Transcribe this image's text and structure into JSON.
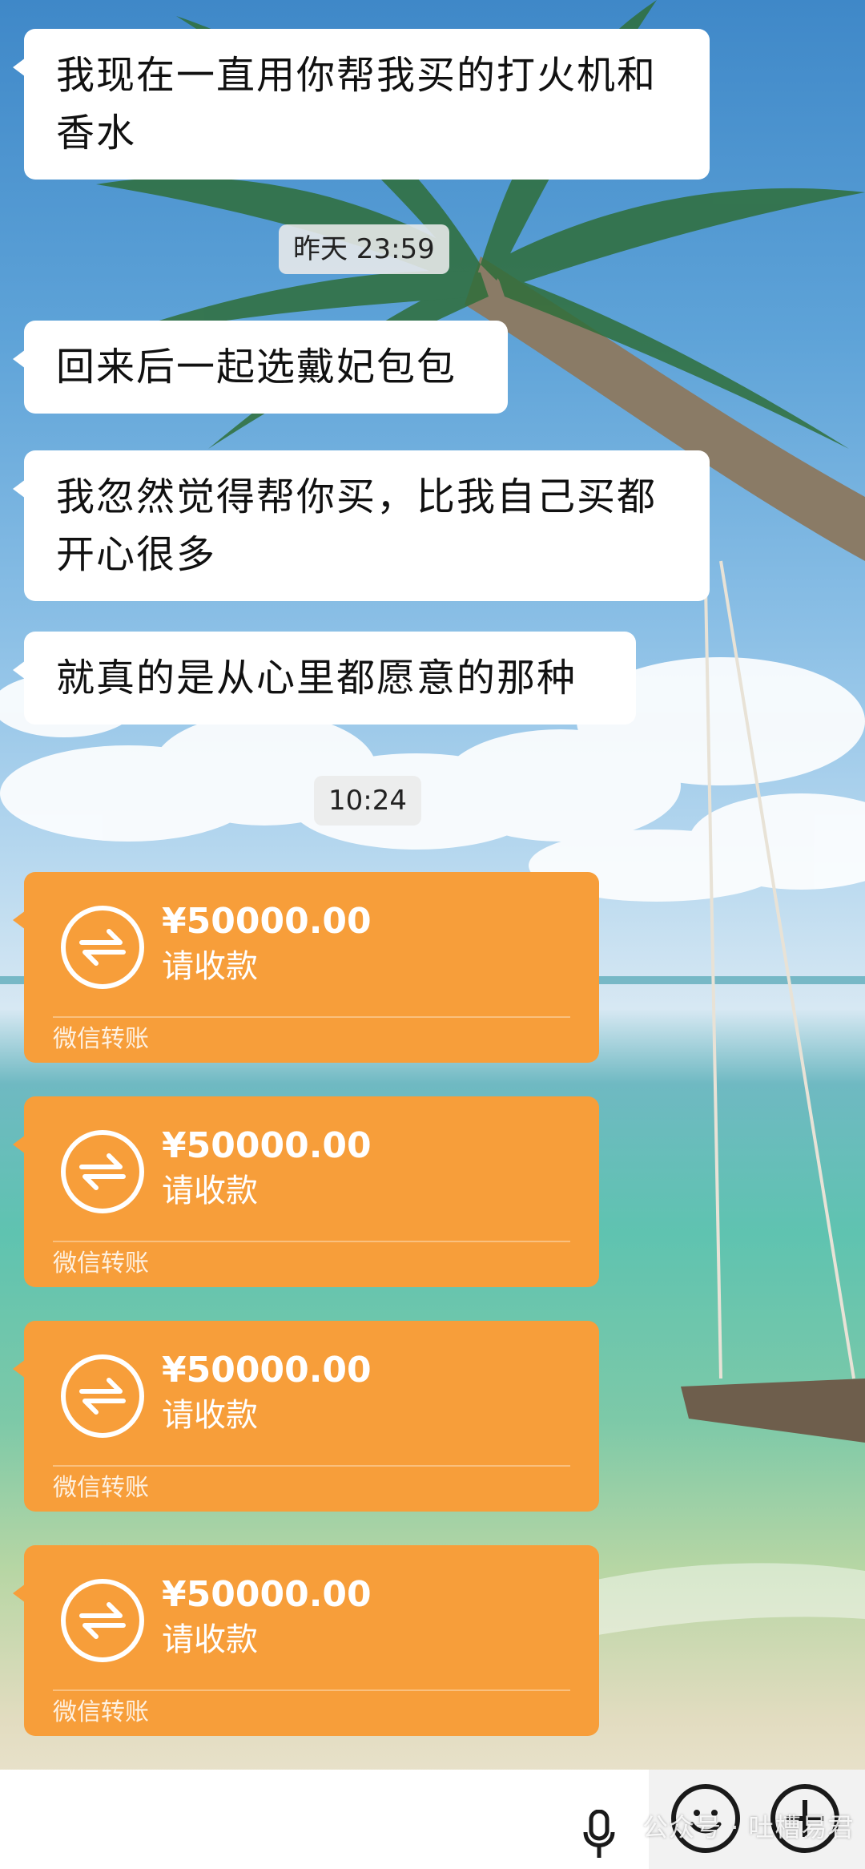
{
  "messages": [
    "我现在一直用你帮我买的打火机和香水",
    "回来后一起选戴妃包包",
    "我忽然觉得帮你买，比我自己买都开心很多",
    "就真的是从心里都愿意的那种"
  ],
  "timestamps": [
    "昨天 23:59",
    "10:24"
  ],
  "transfers": [
    {
      "amount": "¥50000.00",
      "status": "请收款",
      "label": "微信转账"
    },
    {
      "amount": "¥50000.00",
      "status": "请收款",
      "label": "微信转账"
    },
    {
      "amount": "¥50000.00",
      "status": "请收款",
      "label": "微信转账"
    },
    {
      "amount": "¥50000.00",
      "status": "请收款",
      "label": "微信转账"
    }
  ],
  "input_bar": {
    "icons": [
      "microphone-icon",
      "emoji-icon",
      "plus-icon"
    ]
  },
  "watermark": "公众号 · 吐槽易君",
  "colors": {
    "transfer_card": "#f79e3a",
    "bubble": "#ffffff",
    "timestamp_bg": "#ebebeb"
  }
}
